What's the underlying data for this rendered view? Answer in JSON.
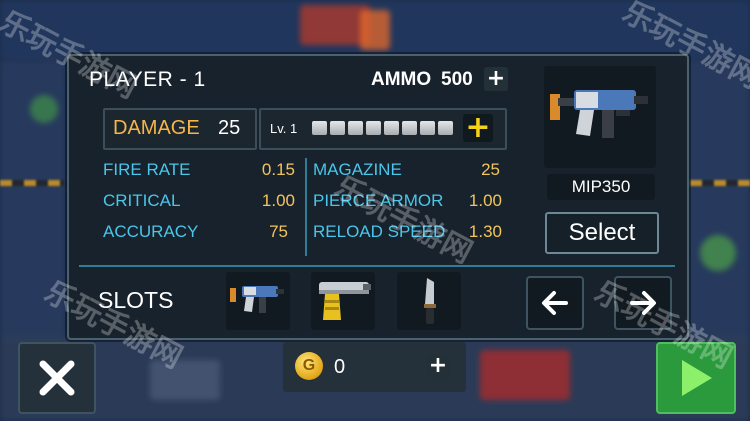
{
  "player": {
    "label": "PLAYER - 1"
  },
  "ammo": {
    "label": "AMMO",
    "value": "500"
  },
  "damage": {
    "label": "DAMAGE",
    "value": "25"
  },
  "level": {
    "label": "Lv. 1",
    "segments_total": 8
  },
  "stats_left": [
    {
      "name": "FIRE RATE",
      "value": "0.15"
    },
    {
      "name": "CRITICAL",
      "value": "1.00"
    },
    {
      "name": "ACCURACY",
      "value": "75"
    }
  ],
  "stats_right": [
    {
      "name": "MAGAZINE",
      "value": "25"
    },
    {
      "name": "PIERCE ARMOR",
      "value": "1.00"
    },
    {
      "name": "RELOAD SPEED",
      "value": "1.30"
    }
  ],
  "weapon": {
    "name": "MIP350",
    "select_label": "Select",
    "icon": "smg-gun-icon"
  },
  "slots": {
    "label": "SLOTS",
    "items": [
      {
        "icon": "smg-gun-icon"
      },
      {
        "icon": "heavy-pistol-icon"
      },
      {
        "icon": "knife-icon"
      }
    ]
  },
  "coins": {
    "value": "0",
    "icon": "gold-coin-icon",
    "coin_letter": "G"
  },
  "colors": {
    "accent_blue": "#49c6ea",
    "value_yellow": "#f2c55a",
    "damage_orange": "#f5b64a",
    "play_green": "#2a9a3c"
  },
  "watermark": "乐玩手游网"
}
